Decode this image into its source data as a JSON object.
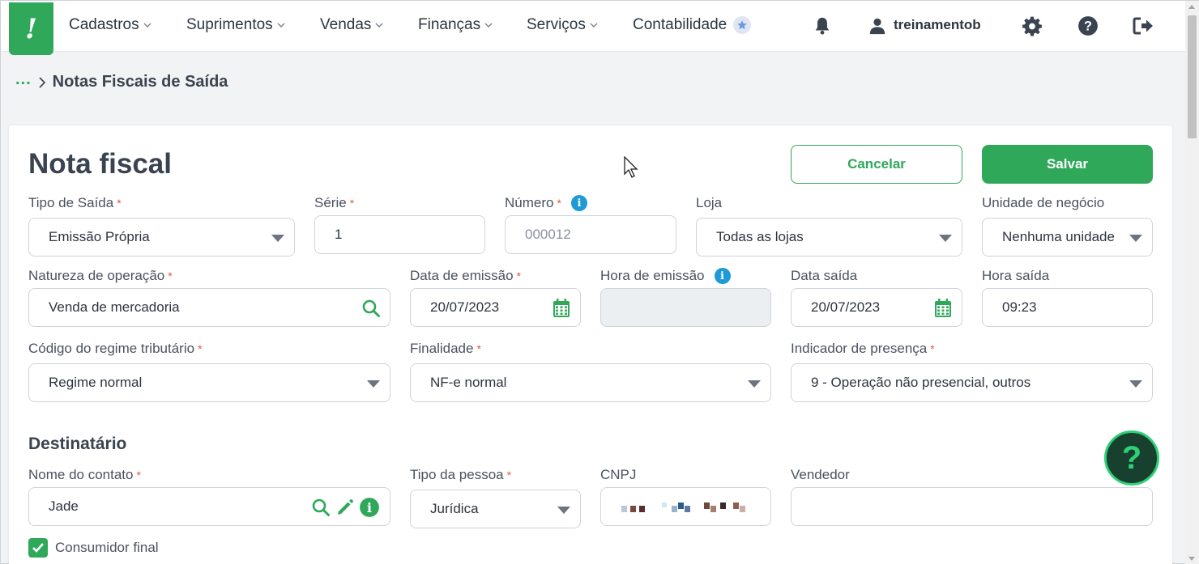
{
  "nav": {
    "items": [
      {
        "label": "Cadastros"
      },
      {
        "label": "Suprimentos"
      },
      {
        "label": "Vendas"
      },
      {
        "label": "Finanças"
      },
      {
        "label": "Serviços"
      },
      {
        "label": "Contabilidade"
      }
    ],
    "user": "treinamentob"
  },
  "breadcrumb": {
    "ellipsis": "...",
    "current": "Notas Fiscais de Saída"
  },
  "form": {
    "title": "Nota fiscal",
    "cancel_label": "Cancelar",
    "save_label": "Salvar",
    "tipo_saida": {
      "label": "Tipo de Saída",
      "value": "Emissão Própria"
    },
    "serie": {
      "label": "Série",
      "value": "1"
    },
    "numero": {
      "label": "Número",
      "placeholder": "000012"
    },
    "loja": {
      "label": "Loja",
      "value": "Todas as lojas"
    },
    "unidade": {
      "label": "Unidade de negócio",
      "value": "Nenhuma unidade"
    },
    "natureza": {
      "label": "Natureza de operação",
      "value": "Venda de mercadoria"
    },
    "data_emissao": {
      "label": "Data de emissão",
      "value": "20/07/2023"
    },
    "hora_emissao": {
      "label": "Hora de emissão",
      "value": ""
    },
    "data_saida": {
      "label": "Data saída",
      "value": "20/07/2023"
    },
    "hora_saida": {
      "label": "Hora saída",
      "value": "09:23"
    },
    "regime": {
      "label": "Código do regime tributário",
      "value": "Regime normal"
    },
    "finalidade": {
      "label": "Finalidade",
      "value": "NF-e normal"
    },
    "presenca": {
      "label": "Indicador de presença",
      "value": "9 - Operação não presencial, outros"
    },
    "required_mark": "*"
  },
  "destinatario": {
    "title": "Destinatário",
    "contato": {
      "label": "Nome do contato",
      "value": "Jade"
    },
    "tipo_pessoa": {
      "label": "Tipo da pessoa",
      "value": "Jurídica"
    },
    "cnpj": {
      "label": "CNPJ"
    },
    "vendedor": {
      "label": "Vendedor",
      "value": ""
    },
    "consumidor_final": {
      "label": "Consumidor final",
      "checked": true
    }
  },
  "help": {
    "symbol": "?"
  },
  "colors": {
    "brand": "#2fa85a",
    "info": "#1e9bd7",
    "required": "#e0593a"
  }
}
